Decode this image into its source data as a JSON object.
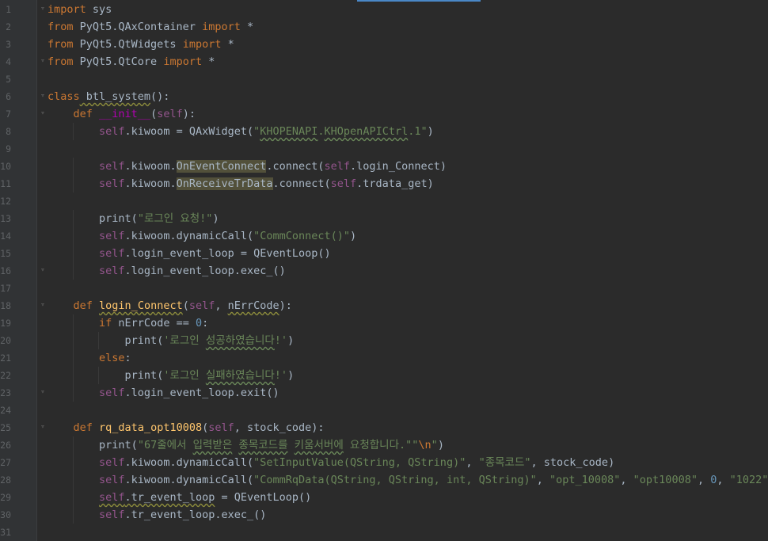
{
  "editor": {
    "line_numbers": [
      "1",
      "2",
      "3",
      "4",
      "5",
      "6",
      "7",
      "8",
      "9",
      "10",
      "11",
      "12",
      "13",
      "14",
      "15",
      "16",
      "17",
      "18",
      "19",
      "20",
      "21",
      "22",
      "23",
      "24",
      "25",
      "26",
      "27",
      "28",
      "29",
      "30",
      "31"
    ],
    "lines": [
      [
        {
          "t": "import",
          "c": "kw"
        },
        {
          "t": " sys",
          "c": "plain"
        }
      ],
      [
        {
          "t": "from",
          "c": "kw"
        },
        {
          "t": " PyQt5.QAxContainer ",
          "c": "plain"
        },
        {
          "t": "import",
          "c": "kw"
        },
        {
          "t": " *",
          "c": "plain"
        }
      ],
      [
        {
          "t": "from",
          "c": "kw"
        },
        {
          "t": " PyQt5.QtWidgets ",
          "c": "plain"
        },
        {
          "t": "import",
          "c": "kw"
        },
        {
          "t": " *",
          "c": "plain"
        }
      ],
      [
        {
          "t": "from",
          "c": "kw"
        },
        {
          "t": " PyQt5.QtCore ",
          "c": "plain"
        },
        {
          "t": "import",
          "c": "kw"
        },
        {
          "t": " *",
          "c": "plain"
        }
      ],
      [],
      [
        {
          "t": "class",
          "c": "kw"
        },
        {
          "t": " btl_system",
          "c": "plain wavy-g"
        },
        {
          "t": "():",
          "c": "plain"
        }
      ],
      [
        {
          "t": "    ",
          "c": "plain"
        },
        {
          "t": "def",
          "c": "kw"
        },
        {
          "t": " ",
          "c": "plain"
        },
        {
          "t": "__init__",
          "c": "magic"
        },
        {
          "t": "(",
          "c": "plain"
        },
        {
          "t": "self",
          "c": "self"
        },
        {
          "t": "):",
          "c": "plain"
        }
      ],
      [
        {
          "t": "        ",
          "c": "plain"
        },
        {
          "t": "self",
          "c": "self"
        },
        {
          "t": ".kiwoom = QAxWidget(",
          "c": "plain"
        },
        {
          "t": "\"",
          "c": "str"
        },
        {
          "t": "KHOPENAPI",
          "c": "str wavy"
        },
        {
          "t": ".",
          "c": "str"
        },
        {
          "t": "KHOpenAPICtrl",
          "c": "str wavy"
        },
        {
          "t": ".1\"",
          "c": "str"
        },
        {
          "t": ")",
          "c": "plain"
        }
      ],
      [],
      [
        {
          "t": "        ",
          "c": "plain"
        },
        {
          "t": "self",
          "c": "self"
        },
        {
          "t": ".kiwoom.",
          "c": "plain"
        },
        {
          "t": "OnEventConnect",
          "c": "plain hl"
        },
        {
          "t": ".connect(",
          "c": "plain"
        },
        {
          "t": "self",
          "c": "self"
        },
        {
          "t": ".login_Connect)",
          "c": "plain"
        }
      ],
      [
        {
          "t": "        ",
          "c": "plain"
        },
        {
          "t": "self",
          "c": "self"
        },
        {
          "t": ".kiwoom.",
          "c": "plain"
        },
        {
          "t": "OnReceiveTrData",
          "c": "plain hl"
        },
        {
          "t": ".connect(",
          "c": "plain"
        },
        {
          "t": "self",
          "c": "self"
        },
        {
          "t": ".trdata_get)",
          "c": "plain"
        }
      ],
      [],
      [
        {
          "t": "        ",
          "c": "plain"
        },
        {
          "t": "print",
          "c": "plain"
        },
        {
          "t": "(",
          "c": "plain"
        },
        {
          "t": "\"로그인 요청!\"",
          "c": "str"
        },
        {
          "t": ")",
          "c": "plain"
        }
      ],
      [
        {
          "t": "        ",
          "c": "plain"
        },
        {
          "t": "self",
          "c": "self"
        },
        {
          "t": ".kiwoom.dynamicCall(",
          "c": "plain"
        },
        {
          "t": "\"CommConnect()\"",
          "c": "str"
        },
        {
          "t": ")",
          "c": "plain"
        }
      ],
      [
        {
          "t": "        ",
          "c": "plain"
        },
        {
          "t": "self",
          "c": "self"
        },
        {
          "t": ".login_event_loop = QEventLoop()",
          "c": "plain"
        }
      ],
      [
        {
          "t": "        ",
          "c": "plain"
        },
        {
          "t": "self",
          "c": "self"
        },
        {
          "t": ".login_event_loop.exec_()",
          "c": "plain"
        }
      ],
      [],
      [
        {
          "t": "    ",
          "c": "plain"
        },
        {
          "t": "def",
          "c": "kw"
        },
        {
          "t": " ",
          "c": "plain"
        },
        {
          "t": "login_Connect",
          "c": "fn wavy-g"
        },
        {
          "t": "(",
          "c": "plain"
        },
        {
          "t": "self",
          "c": "self"
        },
        {
          "t": ", ",
          "c": "plain"
        },
        {
          "t": "nErrCode",
          "c": "plain wavy-g"
        },
        {
          "t": "):",
          "c": "plain"
        }
      ],
      [
        {
          "t": "        ",
          "c": "plain"
        },
        {
          "t": "if",
          "c": "kw"
        },
        {
          "t": " nErrCode == ",
          "c": "plain"
        },
        {
          "t": "0",
          "c": "num"
        },
        {
          "t": ":",
          "c": "plain"
        }
      ],
      [
        {
          "t": "            ",
          "c": "plain"
        },
        {
          "t": "print",
          "c": "plain"
        },
        {
          "t": "(",
          "c": "plain"
        },
        {
          "t": "'로그인 ",
          "c": "str"
        },
        {
          "t": "성공하였습니다",
          "c": "str wavy"
        },
        {
          "t": "!'",
          "c": "str"
        },
        {
          "t": ")",
          "c": "plain"
        }
      ],
      [
        {
          "t": "        ",
          "c": "plain"
        },
        {
          "t": "else",
          "c": "kw"
        },
        {
          "t": ":",
          "c": "plain"
        }
      ],
      [
        {
          "t": "            ",
          "c": "plain"
        },
        {
          "t": "print",
          "c": "plain"
        },
        {
          "t": "(",
          "c": "plain"
        },
        {
          "t": "'로그인 ",
          "c": "str"
        },
        {
          "t": "실패하였습니다",
          "c": "str wavy"
        },
        {
          "t": "!'",
          "c": "str"
        },
        {
          "t": ")",
          "c": "plain"
        }
      ],
      [
        {
          "t": "        ",
          "c": "plain"
        },
        {
          "t": "self",
          "c": "self"
        },
        {
          "t": ".login_event_loop.exit()",
          "c": "plain"
        }
      ],
      [],
      [
        {
          "t": "    ",
          "c": "plain"
        },
        {
          "t": "def",
          "c": "kw"
        },
        {
          "t": " ",
          "c": "plain"
        },
        {
          "t": "rq_data_opt10008",
          "c": "fn"
        },
        {
          "t": "(",
          "c": "plain"
        },
        {
          "t": "self",
          "c": "self"
        },
        {
          "t": ", stock_code):",
          "c": "plain"
        }
      ],
      [
        {
          "t": "        ",
          "c": "plain"
        },
        {
          "t": "print",
          "c": "plain"
        },
        {
          "t": "(",
          "c": "plain"
        },
        {
          "t": "\"67줄에서 ",
          "c": "str"
        },
        {
          "t": "입력받은",
          "c": "str wavy"
        },
        {
          "t": " ",
          "c": "str"
        },
        {
          "t": "종목코드를",
          "c": "str wavy"
        },
        {
          "t": " ",
          "c": "str"
        },
        {
          "t": "키움서버에",
          "c": "str wavy"
        },
        {
          "t": " 요청합니다.\"",
          "c": "str"
        },
        {
          "t": "\"",
          "c": "str"
        },
        {
          "t": "\\n",
          "c": "esc"
        },
        {
          "t": "\"",
          "c": "str"
        },
        {
          "t": ")",
          "c": "plain"
        }
      ],
      [
        {
          "t": "        ",
          "c": "plain"
        },
        {
          "t": "self",
          "c": "self"
        },
        {
          "t": ".kiwoom.dynamicCall(",
          "c": "plain"
        },
        {
          "t": "\"SetInputValue(QString, QString)\"",
          "c": "str"
        },
        {
          "t": ", ",
          "c": "plain"
        },
        {
          "t": "\"종목코드\"",
          "c": "str"
        },
        {
          "t": ", stock_code)",
          "c": "plain"
        }
      ],
      [
        {
          "t": "        ",
          "c": "plain"
        },
        {
          "t": "self",
          "c": "self"
        },
        {
          "t": ".kiwoom.dynamicCall(",
          "c": "plain"
        },
        {
          "t": "\"CommRqData(QString, QString, int, QString)\"",
          "c": "str"
        },
        {
          "t": ", ",
          "c": "plain"
        },
        {
          "t": "\"opt_10008\"",
          "c": "str"
        },
        {
          "t": ", ",
          "c": "plain"
        },
        {
          "t": "\"opt10008\"",
          "c": "str"
        },
        {
          "t": ", ",
          "c": "plain"
        },
        {
          "t": "0",
          "c": "num"
        },
        {
          "t": ", ",
          "c": "plain"
        },
        {
          "t": "\"1022\"",
          "c": "str"
        },
        {
          "t": ")",
          "c": "plain"
        }
      ],
      [
        {
          "t": "        ",
          "c": "plain"
        },
        {
          "t": "self",
          "c": "self wavy-g"
        },
        {
          "t": ".tr_event_loop",
          "c": "plain wavy-g"
        },
        {
          "t": " = QEventLoop()",
          "c": "plain"
        }
      ],
      [
        {
          "t": "        ",
          "c": "plain"
        },
        {
          "t": "self",
          "c": "self"
        },
        {
          "t": ".tr_event_loop.exec_()",
          "c": "plain"
        }
      ],
      []
    ],
    "fold_lines": [
      1,
      4,
      6,
      7,
      16,
      18,
      23,
      25
    ]
  },
  "colors": {
    "background": "#2b2b2b",
    "gutter": "#313335",
    "keyword": "#cc7832",
    "string": "#6a8759",
    "self": "#94558d",
    "function": "#ffc66d",
    "number": "#6897bb",
    "text": "#a9b7c6"
  }
}
